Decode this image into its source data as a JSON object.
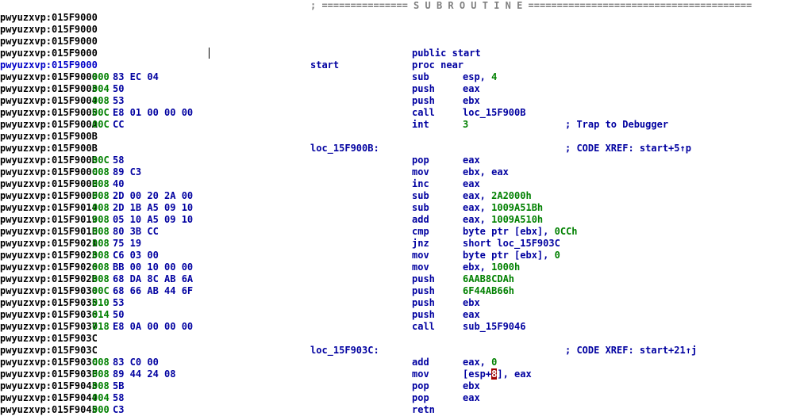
{
  "header_line": "; =============== S U B R O U T I N E =======================================",
  "lines": [
    {
      "addr": "pwyuzxvp:015F9000"
    },
    {
      "addr": "pwyuzxvp:015F9000"
    },
    {
      "addr": "pwyuzxvp:015F9000"
    },
    {
      "addr": "pwyuzxvp:015F9000",
      "mnem": "public start"
    },
    {
      "addr": "pwyuzxvp:015F9000",
      "current": true,
      "label": "start",
      "mnem": "proc near"
    },
    {
      "addr": "pwyuzxvp:015F9000",
      "sp": "000",
      "bytes": "83 EC 04",
      "mnem": "sub",
      "op": "esp,",
      "opn": " 4"
    },
    {
      "addr": "pwyuzxvp:015F9003",
      "sp": "004",
      "bytes": "50",
      "mnem": "push",
      "op": "eax"
    },
    {
      "addr": "pwyuzxvp:015F9004",
      "sp": "008",
      "bytes": "53",
      "mnem": "push",
      "op": "ebx"
    },
    {
      "addr": "pwyuzxvp:015F9005",
      "sp": "00C",
      "bytes": "E8 01 00 00 00",
      "mnem": "call",
      "op": "loc_15F900B"
    },
    {
      "addr": "pwyuzxvp:015F900A",
      "sp": "00C",
      "bytes": "CC",
      "mnem": "int",
      "opn": "3",
      "comment": "; Trap to Debugger"
    },
    {
      "addr": "pwyuzxvp:015F900B"
    },
    {
      "addr": "pwyuzxvp:015F900B",
      "label": "loc_15F900B:",
      "comment": "; CODE XREF: start+5↑p"
    },
    {
      "addr": "pwyuzxvp:015F900B",
      "sp": "00C",
      "bytes": "58",
      "mnem": "pop",
      "op": "eax"
    },
    {
      "addr": "pwyuzxvp:015F900C",
      "sp": "008",
      "bytes": "89 C3",
      "mnem": "mov",
      "op": "ebx, eax"
    },
    {
      "addr": "pwyuzxvp:015F900E",
      "sp": "008",
      "bytes": "40",
      "mnem": "inc",
      "op": "eax"
    },
    {
      "addr": "pwyuzxvp:015F900F",
      "sp": "008",
      "bytes": "2D 00 20 2A 00",
      "mnem": "sub",
      "op": "eax,",
      "opn": " 2A2000h"
    },
    {
      "addr": "pwyuzxvp:015F9014",
      "sp": "008",
      "bytes": "2D 1B A5 09 10",
      "mnem": "sub",
      "op": "eax,",
      "opn": " 1009A51Bh"
    },
    {
      "addr": "pwyuzxvp:015F9019",
      "sp": "008",
      "bytes": "05 10 A5 09 10",
      "mnem": "add",
      "op": "eax,",
      "opn": " 1009A510h"
    },
    {
      "addr": "pwyuzxvp:015F901E",
      "sp": "008",
      "bytes": "80 3B CC",
      "mnem": "cmp",
      "op": "byte ptr [ebx],",
      "opn": " 0CCh"
    },
    {
      "addr": "pwyuzxvp:015F9021",
      "sp": "008",
      "bytes": "75 19",
      "mnem": "jnz",
      "op": "short loc_15F903C"
    },
    {
      "addr": "pwyuzxvp:015F9023",
      "sp": "008",
      "bytes": "C6 03 00",
      "mnem": "mov",
      "op": "byte ptr [ebx],",
      "opn": " 0"
    },
    {
      "addr": "pwyuzxvp:015F9026",
      "sp": "008",
      "bytes": "BB 00 10 00 00",
      "mnem": "mov",
      "op": "ebx,",
      "opn": " 1000h"
    },
    {
      "addr": "pwyuzxvp:015F902B",
      "sp": "008",
      "bytes": "68 DA 8C AB 6A",
      "mnem": "push",
      "opn": "6AAB8CDAh"
    },
    {
      "addr": "pwyuzxvp:015F9030",
      "sp": "00C",
      "bytes": "68 66 AB 44 6F",
      "mnem": "push",
      "opn": "6F44AB66h"
    },
    {
      "addr": "pwyuzxvp:015F9035",
      "sp": "010",
      "bytes": "53",
      "mnem": "push",
      "op": "ebx"
    },
    {
      "addr": "pwyuzxvp:015F9036",
      "sp": "014",
      "bytes": "50",
      "mnem": "push",
      "op": "eax"
    },
    {
      "addr": "pwyuzxvp:015F9037",
      "sp": "018",
      "bytes": "E8 0A 00 00 00",
      "mnem": "call",
      "op": "sub_15F9046"
    },
    {
      "addr": "pwyuzxvp:015F903C"
    },
    {
      "addr": "pwyuzxvp:015F903C",
      "label": "loc_15F903C:",
      "comment": "; CODE XREF: start+21↑j"
    },
    {
      "addr": "pwyuzxvp:015F903C",
      "sp": "008",
      "bytes": "83 C0 00",
      "mnem": "add",
      "op": "eax,",
      "opn": " 0"
    },
    {
      "addr": "pwyuzxvp:015F903F",
      "sp": "008",
      "bytes": "89 44 24 08",
      "mnem": "mov",
      "op": "[esp+",
      "mark": "8",
      "op2": "], eax"
    },
    {
      "addr": "pwyuzxvp:015F9043",
      "sp": "008",
      "bytes": "5B",
      "mnem": "pop",
      "op": "ebx"
    },
    {
      "addr": "pwyuzxvp:015F9044",
      "sp": "004",
      "bytes": "58",
      "mnem": "pop",
      "op": "eax"
    },
    {
      "addr": "pwyuzxvp:015F9045",
      "sp": "000",
      "bytes": "C3",
      "mnem": "retn"
    }
  ]
}
